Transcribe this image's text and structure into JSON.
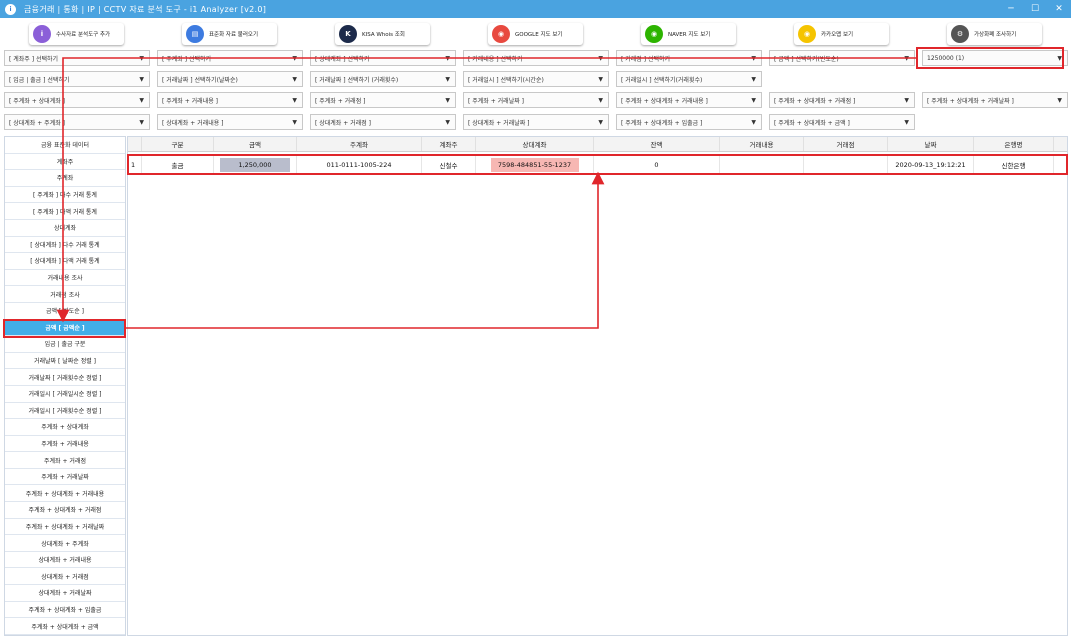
{
  "window": {
    "title": "금융거래 | 통화 | IP | CCTV 자료 분석 도구 - i1 Analyzer [v2.0]",
    "minimize": "─",
    "maximize": "☐",
    "close": "✕"
  },
  "toolbar": [
    {
      "label": "수사자료 분석도구 추가",
      "icon": "app-icon",
      "color": "#8b5fd8",
      "glyph": "i"
    },
    {
      "label": "표준화 자료 불러오기",
      "icon": "document-icon",
      "color": "#3d7be0",
      "glyph": "▤"
    },
    {
      "label": "KISA Whois 조회",
      "icon": "kisa-icon",
      "color": "#1c2a4a",
      "glyph": "K"
    },
    {
      "label": "GOOGLE 지도 보기",
      "icon": "google-maps-icon",
      "color": "#e8493f",
      "glyph": "◉"
    },
    {
      "label": "NAVER 지도 보기",
      "icon": "naver-map-icon",
      "color": "#2db400",
      "glyph": "◉"
    },
    {
      "label": "카카오맵 보기",
      "icon": "kakao-map-icon",
      "color": "#f5c400",
      "glyph": "◉"
    },
    {
      "label": "가상화폐 조사하기",
      "icon": "crypto-icon",
      "color": "#555555",
      "glyph": "⚙"
    }
  ],
  "filters": {
    "row1": [
      "[ 계좌주 ] 선택하기",
      "[ 주계좌 ] 선택하기",
      "[ 상대계좌 ] 선택하기",
      "[ 거래내용 ] 선택하기",
      "[ 거래점 ] 선택하기",
      "[ 금액 ] 선택하기(빈도순)",
      "1250000 (1)"
    ],
    "row2": [
      "[ 입금 | 출금 ] 선택하기",
      "[ 거래날짜 ] 선택하기(날짜순)",
      "[ 거래날짜 ] 선택하기 (거래횟수)",
      "[ 거래일시 ] 선택하기(시간순)",
      "[ 거래일시 ] 선택하기(거래횟수)"
    ],
    "row3": [
      "[ 주계좌 + 상대계좌 ]",
      "[ 주계좌 + 거래내용 ]",
      "[ 주계좌 + 거래점 ]",
      "[ 주계좌 + 거래날짜 ]",
      "[ 주계좌 + 상대계좌 + 거래내용 ]",
      "[ 주계좌 + 상대계좌 + 거래점 ]",
      "[ 주계좌 + 상대계좌 + 거래날짜 ]"
    ],
    "row4": [
      "[ 상대계좌 + 주계좌 ]",
      "[ 상대계좌 + 거래내용 ]",
      "[ 상대계좌 + 거래점 ]",
      "[ 상대계좌 + 거래날짜 ]",
      "[ 주계좌 + 상대계좌 + 입출금 ]",
      "[ 주계좌 + 상대계좌 + 금액 ]"
    ]
  },
  "sidebar": [
    "금융 표준화 데이터",
    "계좌주",
    "주계좌",
    "[ 주계좌 ] 다수 거래 통계",
    "[ 주계좌 ] 다액 거래 통계",
    "상대계좌",
    "[ 상대계좌 ] 다수 거래 통계",
    "[ 상대계좌 ] 다액 거래 통계",
    "거래내용 조사",
    "거래점 조사",
    "금액 [ 빈도순 ]",
    "금액 [ 금액순 ]",
    "입금 | 출금 구분",
    "거래날짜 [ 날짜순 정렬 ]",
    "거래날짜 [ 거래횟수순 정렬 ]",
    "거래일시 [ 거래일시순 정렬 ]",
    "거래일시 [ 거래횟수순 정렬 ]",
    "주계좌 + 상대계좌",
    "주계좌 + 거래내용",
    "주계좌 + 거래점",
    "주계좌 + 거래날짜",
    "주계좌 + 상대계좌 + 거래내용",
    "주계좌 + 상대계좌 + 거래점",
    "주계좌 + 상대계좌 + 거래날짜",
    "상대계좌 + 주계좌",
    "상대계좌 + 거래내용",
    "상대계좌 + 거래점",
    "상대계좌 + 거래날짜",
    "주계좌 + 상대계좌 + 입출금",
    "주계좌 + 상대계좌 + 금액"
  ],
  "grid": {
    "columns": [
      "구분",
      "금액",
      "주계좌",
      "계좌주",
      "상대계좌",
      "잔액",
      "거래내용",
      "거래점",
      "날짜",
      "은행명"
    ],
    "rows": [
      {
        "no": "1",
        "type": "출금",
        "amount": "1,250,000",
        "account": "011-0111-1005-224",
        "owner": "신철수",
        "counter": "7598-484851-55-1237",
        "balance": "0",
        "content": "",
        "branch": "",
        "date": "2020-09-13_19:12:21",
        "bank": "신한은행"
      }
    ]
  }
}
